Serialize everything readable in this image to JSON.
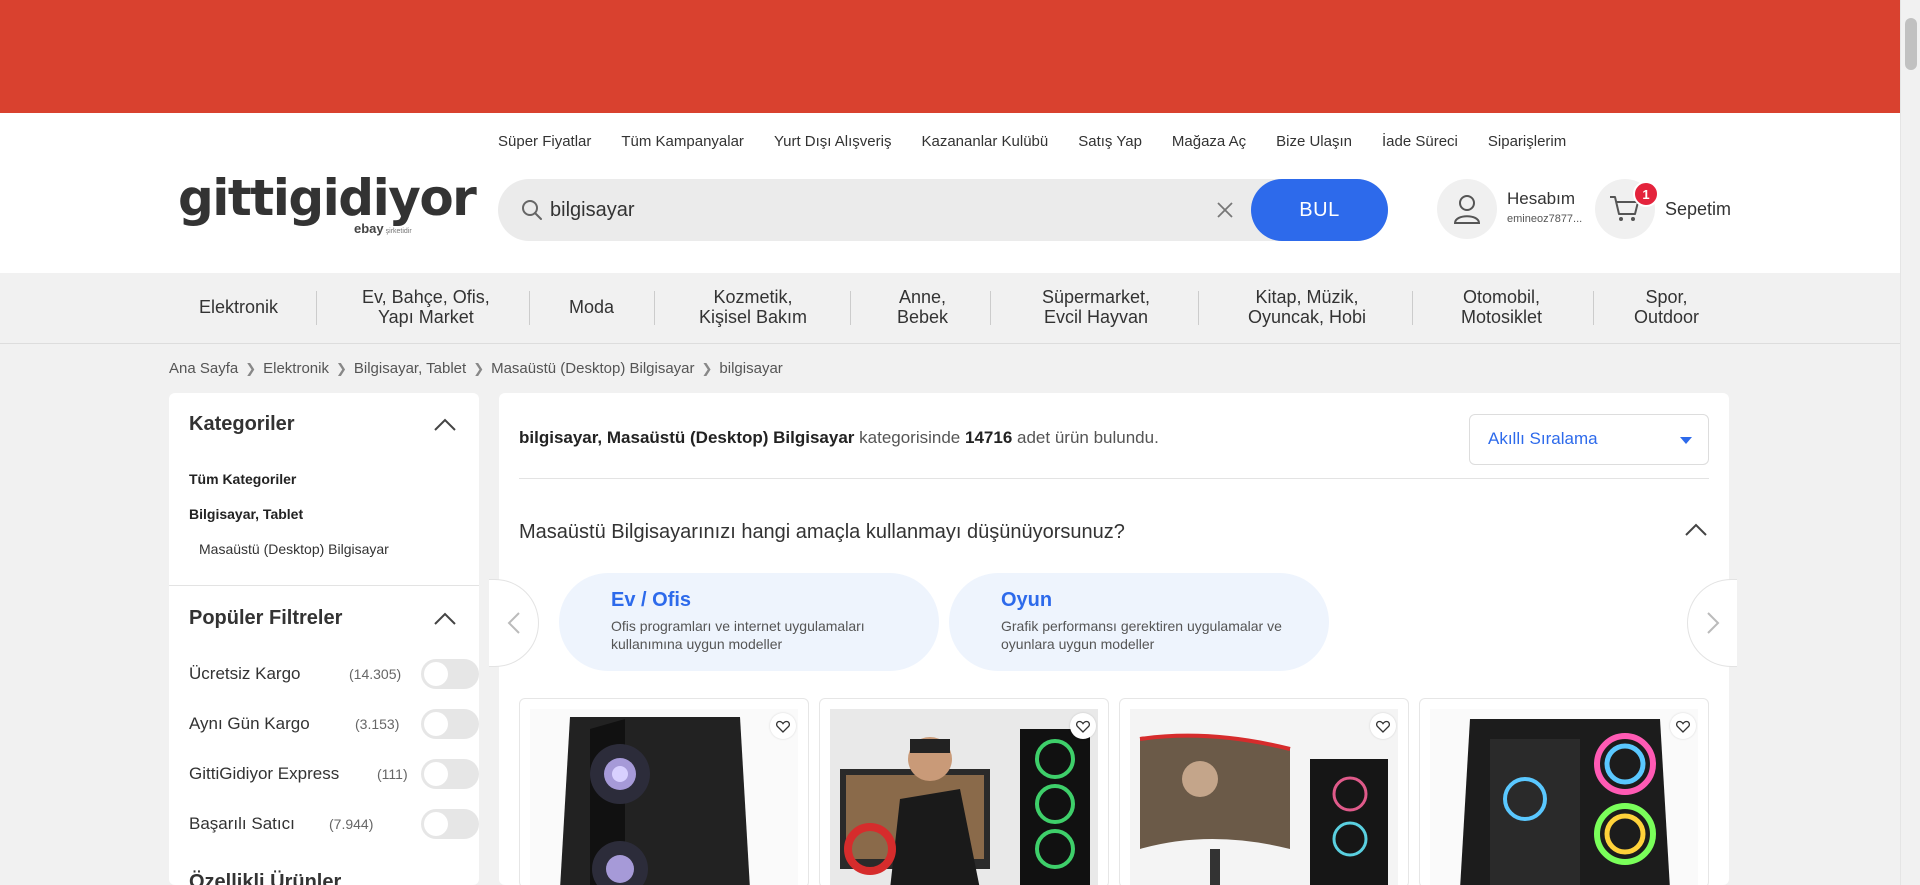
{
  "colors": {
    "banner": "#d9412f",
    "accent": "#2d6aeb",
    "badge": "#e4233c"
  },
  "toplinks": [
    "Süper Fiyatlar",
    "Tüm Kampanyalar",
    "Yurt Dışı Alışveriş",
    "Kazananlar Kulübü",
    "Satış Yap",
    "Mağaza Aç",
    "Bize Ulaşın",
    "İade Süreci",
    "Siparişlerim"
  ],
  "logo": {
    "word": "gittigidiyor",
    "brand": "ebay",
    "tagline": "şirketidir"
  },
  "search": {
    "value": "bilgisayar",
    "button": "BUL",
    "icon": "search-icon",
    "clear_icon": "close-icon"
  },
  "account": {
    "label": "Hesabım",
    "user": "emineoz7877...",
    "icon": "user-icon"
  },
  "cart": {
    "label": "Sepetim",
    "count": "1",
    "icon": "cart-icon"
  },
  "categories": [
    {
      "line1": "Elektronik",
      "line2": ""
    },
    {
      "line1": "Ev, Bahçe, Ofis,",
      "line2": "Yapı Market"
    },
    {
      "line1": "Moda",
      "line2": ""
    },
    {
      "line1": "Kozmetik,",
      "line2": "Kişisel Bakım"
    },
    {
      "line1": "Anne,",
      "line2": "Bebek"
    },
    {
      "line1": "Süpermarket,",
      "line2": "Evcil Hayvan"
    },
    {
      "line1": "Kitap, Müzik,",
      "line2": "Oyuncak, Hobi"
    },
    {
      "line1": "Otomobil,",
      "line2": "Motosiklet"
    },
    {
      "line1": "Spor,",
      "line2": "Outdoor"
    }
  ],
  "breadcrumb": [
    "Ana Sayfa",
    "Elektronik",
    "Bilgisayar, Tablet",
    "Masaüstü (Desktop) Bilgisayar",
    "bilgisayar"
  ],
  "sidebar": {
    "categories_title": "Kategoriler",
    "links": [
      "Tüm Kategoriler",
      "Bilgisayar, Tablet",
      "Masaüstü (Desktop) Bilgisayar"
    ],
    "popular_title": "Popüler Filtreler",
    "filters": [
      {
        "label": "Ücretsiz Kargo",
        "count": "(14.305)"
      },
      {
        "label": "Aynı Gün Kargo",
        "count": "(3.153)"
      },
      {
        "label": "GittiGidiyor Express",
        "count": "(111)"
      },
      {
        "label": "Başarılı Satıcı",
        "count": "(7.944)"
      }
    ],
    "next_title": "Özellikli Ürünler"
  },
  "results": {
    "query": "bilgisayar, Masaüstü (Desktop) Bilgisayar",
    "middle": "kategorisinde",
    "count": "14716",
    "suffix": "adet ürün bulundu."
  },
  "sort": {
    "selected": "Akıllı Sıralama"
  },
  "purpose": {
    "question": "Masaüstü Bilgisayarınızı hangi amaçla kullanmayı düşünüyorsunuz?",
    "options": [
      {
        "title": "Ev / Ofis",
        "desc": "Ofis programları ve internet uygulamaları kullanımına uygun modeller"
      },
      {
        "title": "Oyun",
        "desc": "Grafik performansı gerektiren uygulamalar ve oyunlara uygun modeller"
      }
    ]
  },
  "products": [
    {
      "image": "desktop-tower-black"
    },
    {
      "image": "gaming-pc-with-soldier"
    },
    {
      "image": "curved-monitor-gaming-pc"
    },
    {
      "image": "rgb-fans-tower"
    }
  ]
}
